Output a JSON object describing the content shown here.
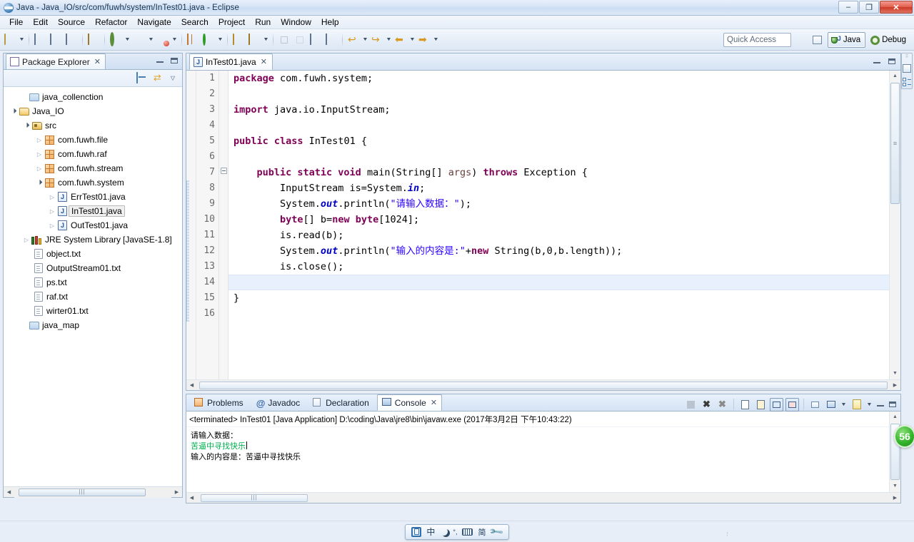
{
  "window": {
    "title": "Java - Java_IO/src/com/fuwh/system/InTest01.java - Eclipse",
    "app_icon": "eclipse-icon",
    "minimize": "–",
    "restore": "❐",
    "close": "✕"
  },
  "menubar": {
    "items": [
      {
        "label": "File",
        "mnemonic": "F"
      },
      {
        "label": "Edit",
        "mnemonic": "E"
      },
      {
        "label": "Source",
        "mnemonic": "S"
      },
      {
        "label": "Refactor",
        "mnemonic": "t"
      },
      {
        "label": "Navigate",
        "mnemonic": "N"
      },
      {
        "label": "Search",
        "mnemonic": "a"
      },
      {
        "label": "Project",
        "mnemonic": "P"
      },
      {
        "label": "Run",
        "mnemonic": "R"
      },
      {
        "label": "Window",
        "mnemonic": "W"
      },
      {
        "label": "Help",
        "mnemonic": "H"
      }
    ]
  },
  "toolbar": {
    "icons": [
      "new-wizard-icon",
      "save-icon",
      "save-all-icon",
      "print-icon",
      "toggle-markoccurrences-icon",
      "debug-icon",
      "run-icon",
      "run-external-tools-icon",
      "new-java-package-icon",
      "refresh-icon",
      "open-type-icon",
      "annotation-icon",
      "previous-annotation-icon",
      "next-annotation-icon",
      "last-edit-location-icon",
      "back-icon",
      "forward-icon"
    ],
    "quick_access_placeholder": "Quick Access",
    "open_perspective_icon": "open-perspective-icon",
    "perspectives": [
      {
        "label": "Java",
        "icon": "java-perspective-icon",
        "active": true
      },
      {
        "label": "Debug",
        "icon": "debug-perspective-icon",
        "active": false
      }
    ]
  },
  "package_explorer": {
    "tab_label": "Package Explorer",
    "tab_icon": "package-explorer-icon",
    "tab_close": "✕",
    "minimize_icon": "minimize-icon",
    "maximize_icon": "maximize-icon",
    "toolbar": [
      "collapse-all-icon",
      "link-with-editor-icon",
      "view-menu-icon"
    ],
    "tree": [
      {
        "label": "java_collenction",
        "icon": "folder-icon",
        "indent": 1,
        "twisty": "none"
      },
      {
        "label": "Java_IO",
        "icon": "project-open-icon",
        "indent": 0,
        "twisty": "open"
      },
      {
        "label": "src",
        "icon": "source-folder-icon",
        "indent": 1,
        "twisty": "open"
      },
      {
        "label": "com.fuwh.file",
        "icon": "package-icon",
        "indent": 2,
        "twisty": "closed"
      },
      {
        "label": "com.fuwh.raf",
        "icon": "package-icon",
        "indent": 2,
        "twisty": "closed"
      },
      {
        "label": "com.fuwh.stream",
        "icon": "package-icon",
        "indent": 2,
        "twisty": "closed"
      },
      {
        "label": "com.fuwh.system",
        "icon": "package-icon",
        "indent": 2,
        "twisty": "open"
      },
      {
        "label": "ErrTest01.java",
        "icon": "java-file-icon",
        "indent": 3,
        "twisty": "closed"
      },
      {
        "label": "InTest01.java",
        "icon": "java-file-icon",
        "indent": 3,
        "twisty": "closed",
        "selected": true
      },
      {
        "label": "OutTest01.java",
        "icon": "java-file-icon",
        "indent": 3,
        "twisty": "closed"
      },
      {
        "label": "JRE System Library",
        "suffix": "[JavaSE-1.8]",
        "icon": "jre-library-icon",
        "indent": 1,
        "twisty": "closed"
      },
      {
        "label": "object.txt",
        "icon": "text-file-icon",
        "indent": 1,
        "twisty": "none"
      },
      {
        "label": "OutputStream01.txt",
        "icon": "text-file-icon",
        "indent": 1,
        "twisty": "none"
      },
      {
        "label": "ps.txt",
        "icon": "text-file-icon",
        "indent": 1,
        "twisty": "none"
      },
      {
        "label": "raf.txt",
        "icon": "text-file-icon",
        "indent": 1,
        "twisty": "none"
      },
      {
        "label": "wirter01.txt",
        "icon": "text-file-icon",
        "indent": 1,
        "twisty": "none"
      },
      {
        "label": "java_map",
        "icon": "folder-icon",
        "indent": 0,
        "twisty": "none"
      }
    ]
  },
  "editor": {
    "tab_label": "InTest01.java",
    "tab_icon": "java-file-icon",
    "tab_close": "✕",
    "minimize_icon": "minimize-icon",
    "maximize_icon": "maximize-icon",
    "highlighted_line": 14,
    "lines": [
      {
        "n": 1,
        "tokens": [
          {
            "t": "package ",
            "c": "kw"
          },
          {
            "t": "com.fuwh.system;",
            "c": ""
          }
        ]
      },
      {
        "n": 2,
        "tokens": []
      },
      {
        "n": 3,
        "tokens": [
          {
            "t": "import ",
            "c": "kw"
          },
          {
            "t": "java.io.InputStream;",
            "c": ""
          }
        ]
      },
      {
        "n": 4,
        "tokens": []
      },
      {
        "n": 5,
        "tokens": [
          {
            "t": "public class ",
            "c": "kw"
          },
          {
            "t": "InTest01 {",
            "c": ""
          }
        ]
      },
      {
        "n": 6,
        "tokens": []
      },
      {
        "n": 7,
        "fold": true,
        "tokens": [
          {
            "t": "    public static void ",
            "c": "kw"
          },
          {
            "t": "main(String[] ",
            "c": ""
          },
          {
            "t": "args",
            "c": "param"
          },
          {
            "t": ") ",
            "c": ""
          },
          {
            "t": "throws ",
            "c": "kw"
          },
          {
            "t": "Exception {",
            "c": ""
          }
        ]
      },
      {
        "n": 8,
        "tokens": [
          {
            "t": "        InputStream is=System.",
            "c": ""
          },
          {
            "t": "in",
            "c": "fld"
          },
          {
            "t": ";",
            "c": ""
          }
        ]
      },
      {
        "n": 9,
        "tokens": [
          {
            "t": "        System.",
            "c": ""
          },
          {
            "t": "out",
            "c": "fld"
          },
          {
            "t": ".println(",
            "c": ""
          },
          {
            "t": "\"请输入数据：\"",
            "c": "st"
          },
          {
            "t": ");",
            "c": ""
          }
        ]
      },
      {
        "n": 10,
        "tokens": [
          {
            "t": "        byte",
            "c": "kw"
          },
          {
            "t": "[] b=",
            "c": ""
          },
          {
            "t": "new byte",
            "c": "kw"
          },
          {
            "t": "[1024];",
            "c": ""
          }
        ]
      },
      {
        "n": 11,
        "tokens": [
          {
            "t": "        is.read(b);",
            "c": ""
          }
        ]
      },
      {
        "n": 12,
        "tokens": [
          {
            "t": "        System.",
            "c": ""
          },
          {
            "t": "out",
            "c": "fld"
          },
          {
            "t": ".println(",
            "c": ""
          },
          {
            "t": "\"输入的内容是:\"",
            "c": "st"
          },
          {
            "t": "+",
            "c": ""
          },
          {
            "t": "new ",
            "c": "kw"
          },
          {
            "t": "String(b,0,b.length));",
            "c": ""
          }
        ]
      },
      {
        "n": 13,
        "tokens": [
          {
            "t": "        is.close();",
            "c": ""
          }
        ]
      },
      {
        "n": 14,
        "tokens": [
          {
            "t": "    }",
            "c": ""
          }
        ]
      },
      {
        "n": 15,
        "tokens": [
          {
            "t": "}",
            "c": ""
          }
        ]
      },
      {
        "n": 16,
        "tokens": []
      }
    ]
  },
  "console": {
    "tabs": [
      {
        "label": "Problems",
        "icon": "problems-icon",
        "active": false
      },
      {
        "label": "Javadoc",
        "icon": "javadoc-icon",
        "active": false
      },
      {
        "label": "Declaration",
        "icon": "declaration-icon",
        "active": false
      },
      {
        "label": "Console",
        "icon": "console-icon",
        "active": true,
        "close": "✕"
      }
    ],
    "toolbar_icons": [
      "terminate-all-icon",
      "remove-launch-icon",
      "remove-all-terminated-icon",
      "clear-console-icon",
      "scroll-lock-icon",
      "show-console-on-output-icon",
      "show-console-on-error-icon",
      "pin-console-icon",
      "display-selected-console-icon",
      "display-selected-console-menu-icon",
      "open-console-icon",
      "open-console-menu-icon",
      "minimize-icon",
      "maximize-icon"
    ],
    "header": "<terminated> InTest01 [Java Application] D:\\coding\\Java\\jre8\\bin\\javaw.exe (2017年3月2日 下午10:43:22)",
    "output_lines": [
      {
        "text": "请输入数据：",
        "color": "#000000"
      },
      {
        "text": "苦逼中寻找快乐",
        "color": "#00b050",
        "caret": true
      },
      {
        "text": "输入的内容是：苦逼中寻找快乐",
        "color": "#000000"
      }
    ]
  },
  "fastview": {
    "icons": [
      "open-perspective-icon",
      "outline-view-icon"
    ]
  },
  "notification_badge": {
    "count": "56"
  },
  "ime": {
    "items": [
      {
        "icon": "ime-logo-icon",
        "label": ""
      },
      {
        "icon": "ime-chinese-icon",
        "label": "中"
      },
      {
        "icon": "ime-moon-icon",
        "label": ""
      },
      {
        "icon": "ime-punctuation-icon",
        "label": "°,"
      },
      {
        "icon": "ime-keyboard-icon",
        "label": ""
      },
      {
        "icon": "ime-simplified-icon",
        "label": "简"
      },
      {
        "icon": "ime-tools-icon",
        "label": ""
      }
    ]
  },
  "colors": {
    "keyword": "#7f0055",
    "string": "#2a00ff",
    "field": "#0000c0",
    "parameter": "#6a3e3e",
    "console_input": "#00b050",
    "accent": "#9fb5cc"
  }
}
